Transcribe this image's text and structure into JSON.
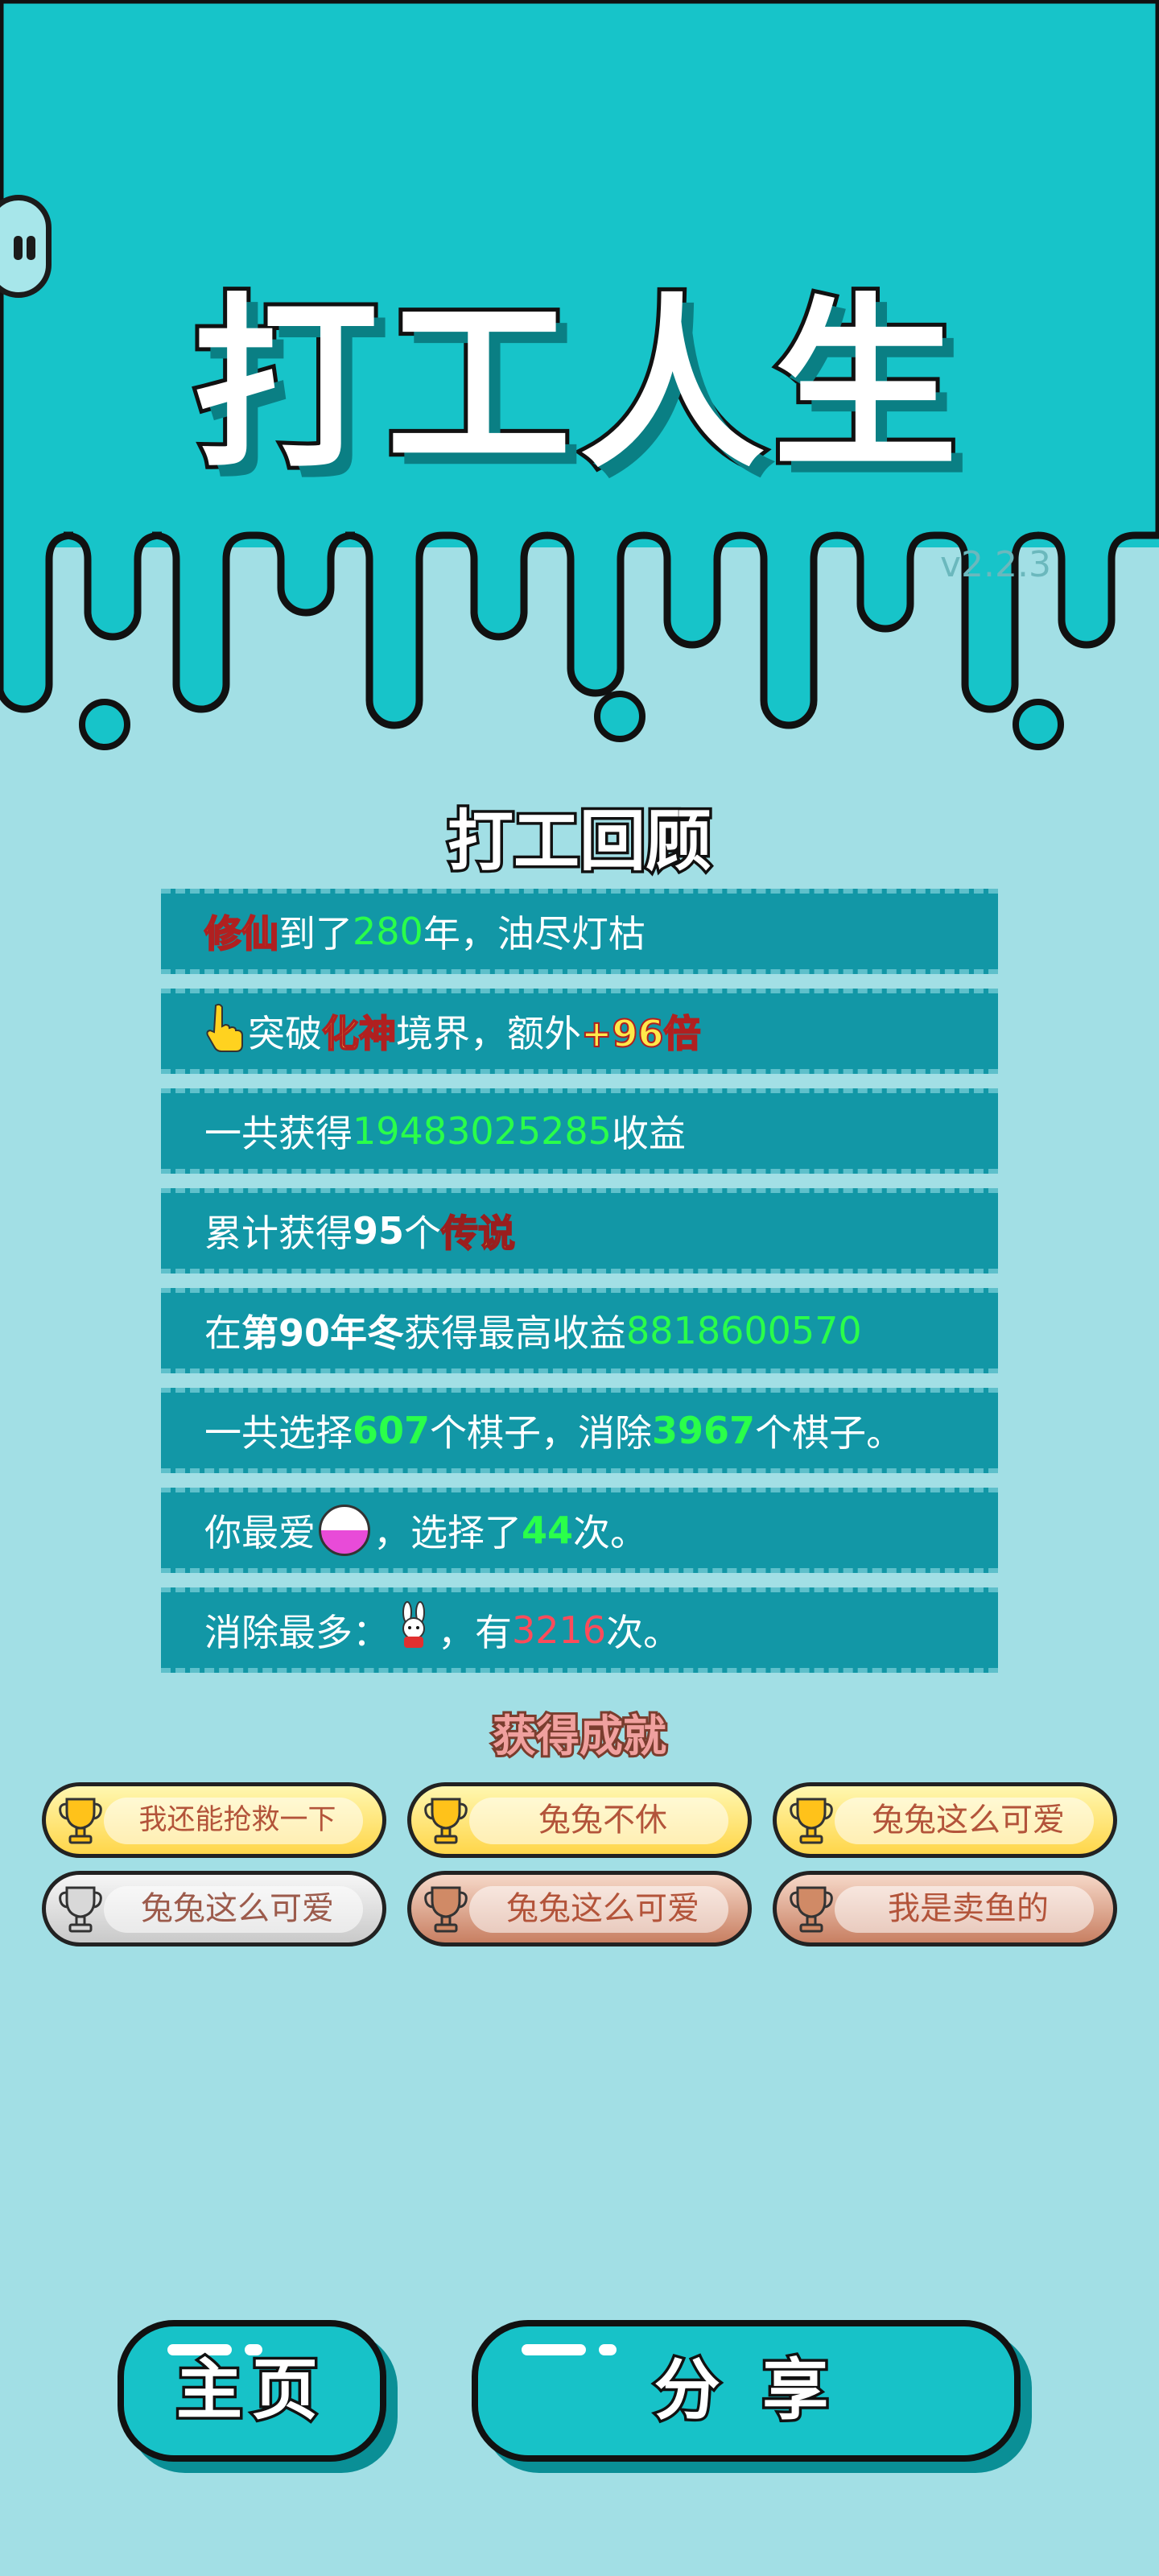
{
  "app": {
    "title": "打工人生",
    "version": "v2.2.3"
  },
  "review": {
    "title": "打工回顾",
    "rows": [
      {
        "a": "修仙",
        "b": "到了",
        "c": "280",
        "d": "年，油尽灯枯"
      },
      {
        "a": "突破",
        "b": "化神",
        "c": "境界，额外",
        "d": "+96倍"
      },
      {
        "a": "一共获得",
        "b": "19483025285",
        "c": "收益"
      },
      {
        "a": "累计获得",
        "b": "95",
        "c": "个",
        "d": "传说"
      },
      {
        "a": "在 ",
        "b": "第90年冬",
        "c": " 获得最高收益",
        "d": "8818600570"
      },
      {
        "a": "一共选择",
        "b": "607",
        "c": "个棋子，消除",
        "d": "3967",
        "e": "个棋子。"
      },
      {
        "a": "你最爱",
        "b": "，选择了",
        "c": "44",
        "d": "次。"
      },
      {
        "a": "消除最多：",
        "b": "，有",
        "c": "3216",
        "d": "次。"
      }
    ]
  },
  "achievements": {
    "title": "获得成就",
    "items": [
      {
        "label": "我还能抢救一下",
        "tier": "gold"
      },
      {
        "label": "兔兔不休",
        "tier": "gold"
      },
      {
        "label": "兔兔这么可爱",
        "tier": "gold"
      },
      {
        "label": "兔兔这么可爱",
        "tier": "silver"
      },
      {
        "label": "兔兔这么可爱",
        "tier": "bronze"
      },
      {
        "label": "我是卖鱼的",
        "tier": "bronze"
      }
    ]
  },
  "buttons": {
    "home": "主页",
    "share": "分 享"
  },
  "colors": {
    "background": "#a2dfe5",
    "teal": "#17c2c8",
    "row": "#1297a6",
    "green_value": "#2aff4a",
    "red_value": "#ff4b5a"
  }
}
